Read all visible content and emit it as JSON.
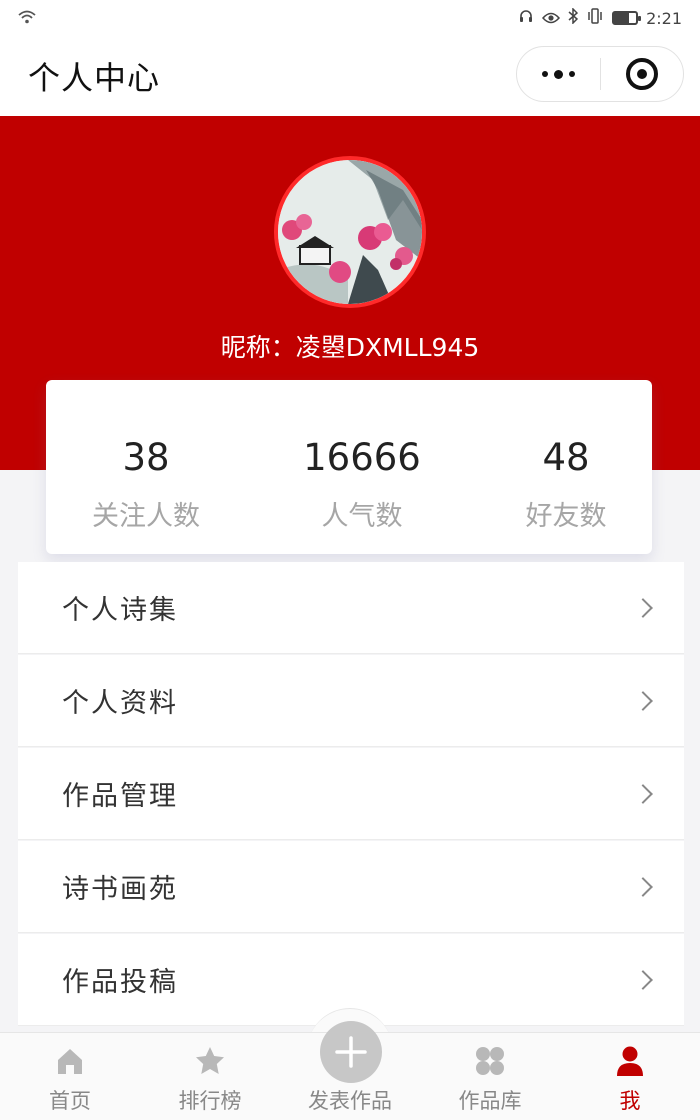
{
  "status_bar": {
    "time": "2:21",
    "wifi_icon": "wifi-icon",
    "icons": [
      "headset-icon",
      "eye-icon",
      "bluetooth-icon",
      "vibrate-icon",
      "battery-icon"
    ],
    "battery_level": 0.7
  },
  "nav": {
    "title": "个人中心",
    "more_icon": "more-dots-icon",
    "close_icon": "target-circle-icon"
  },
  "profile": {
    "nickname": "昵称：凌曌DXMLL945",
    "avatar_icon": "landscape-painting-avatar",
    "colors": {
      "accent": "#c00000",
      "avatar_border": "#ff2a2a"
    }
  },
  "stats": [
    {
      "value": "38",
      "label": "关注人数"
    },
    {
      "value": "16666",
      "label": "人气数"
    },
    {
      "value": "48",
      "label": "好友数"
    }
  ],
  "menu": [
    {
      "label": "个人诗集",
      "icon": "chevron-right-icon"
    },
    {
      "label": "个人资料",
      "icon": "chevron-right-icon"
    },
    {
      "label": "作品管理",
      "icon": "chevron-right-icon"
    },
    {
      "label": "诗书画苑",
      "icon": "chevron-right-icon"
    },
    {
      "label": "作品投稿",
      "icon": "chevron-right-icon"
    }
  ],
  "tabbar": {
    "items": [
      {
        "label": "首页",
        "icon": "home-icon"
      },
      {
        "label": "排行榜",
        "icon": "star-icon"
      },
      {
        "label": "发表作品",
        "icon": "plus-icon"
      },
      {
        "label": "作品库",
        "icon": "grid-dots-icon"
      },
      {
        "label": "我",
        "icon": "user-icon"
      }
    ],
    "active_index": 4,
    "active_color": "#c00000"
  }
}
